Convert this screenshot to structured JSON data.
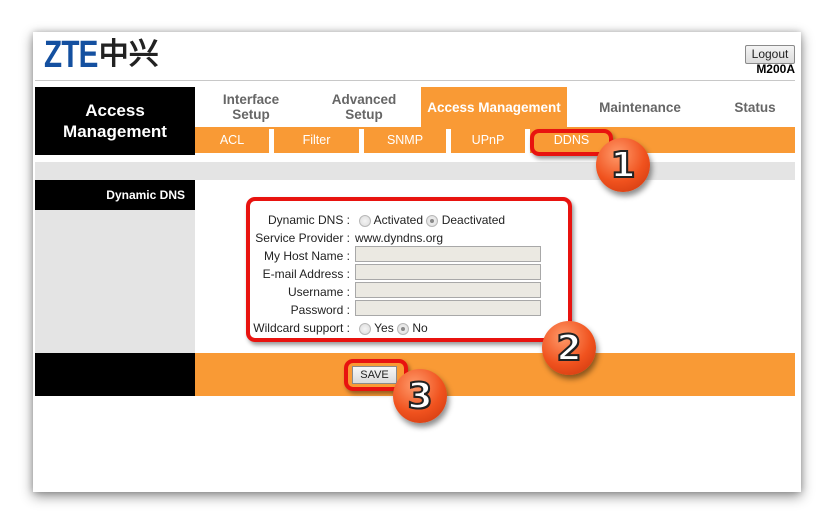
{
  "header": {
    "logo_latin": "ZTE",
    "logo_cn": "中兴",
    "logout_label": "Logout",
    "model": "M200A"
  },
  "nav": {
    "section_title": "Access Management",
    "tabs": [
      {
        "label": "Interface Setup",
        "active": false
      },
      {
        "label": "Advanced Setup",
        "active": false
      },
      {
        "label": "Access Management",
        "active": true
      },
      {
        "label": "Maintenance",
        "active": false
      },
      {
        "label": "Status",
        "active": false
      }
    ],
    "subtabs": [
      {
        "label": "ACL"
      },
      {
        "label": "Filter"
      },
      {
        "label": "SNMP"
      },
      {
        "label": "UPnP"
      },
      {
        "label": "DDNS",
        "active": true
      }
    ]
  },
  "section": {
    "label": "Dynamic DNS"
  },
  "form": {
    "dynamic_dns": {
      "label": "Dynamic DNS :",
      "options": [
        {
          "label": "Activated",
          "checked": false
        },
        {
          "label": "Deactivated",
          "checked": true
        }
      ]
    },
    "service_provider": {
      "label": "Service Provider :",
      "value": "www.dyndns.org"
    },
    "host_name": {
      "label": "My Host Name :",
      "value": ""
    },
    "email": {
      "label": "E-mail Address :",
      "value": ""
    },
    "username": {
      "label": "Username :",
      "value": ""
    },
    "password": {
      "label": "Password :",
      "value": ""
    },
    "wildcard": {
      "label": "Wildcard support :",
      "options": [
        {
          "label": "Yes",
          "checked": false
        },
        {
          "label": "No",
          "checked": true
        }
      ]
    },
    "save_label": "SAVE"
  },
  "annotations": {
    "step1": "1",
    "step2": "2",
    "step3": "3",
    "highlight_color": "#e8130f",
    "accent_color": "#f99a35"
  }
}
